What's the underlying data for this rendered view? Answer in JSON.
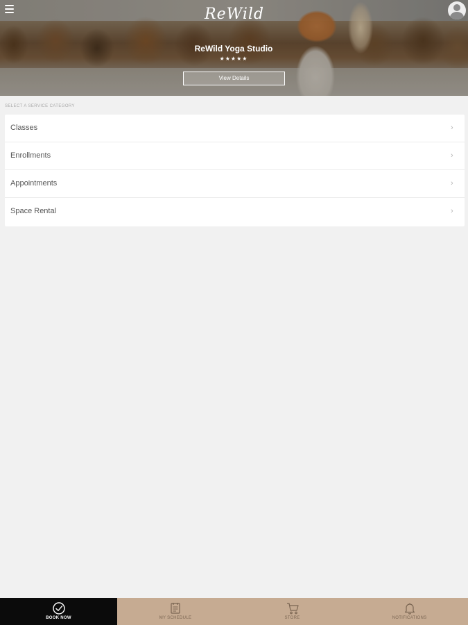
{
  "header": {
    "logo_text": "ReWild",
    "studio_name": "ReWild Yoga Studio",
    "rating_stars": "★★★★★",
    "rating_value": 5,
    "view_details_label": "View Details"
  },
  "categories": {
    "section_label": "SELECT A SERVICE CATEGORY",
    "items": [
      {
        "label": "Classes"
      },
      {
        "label": "Enrollments"
      },
      {
        "label": "Appointments"
      },
      {
        "label": "Space Rental"
      }
    ]
  },
  "bottom_nav": {
    "items": [
      {
        "label": "BOOK NOW",
        "icon": "check-circle-icon",
        "active": true
      },
      {
        "label": "MY SCHEDULE",
        "icon": "calendar-icon",
        "active": false
      },
      {
        "label": "STORE",
        "icon": "cart-icon",
        "active": false
      },
      {
        "label": "NOTIFICATIONS",
        "icon": "bell-icon",
        "active": false
      }
    ]
  },
  "colors": {
    "nav_background": "#c6ab92",
    "nav_active": "#0b0b0b",
    "page_background": "#f1f1f1"
  }
}
